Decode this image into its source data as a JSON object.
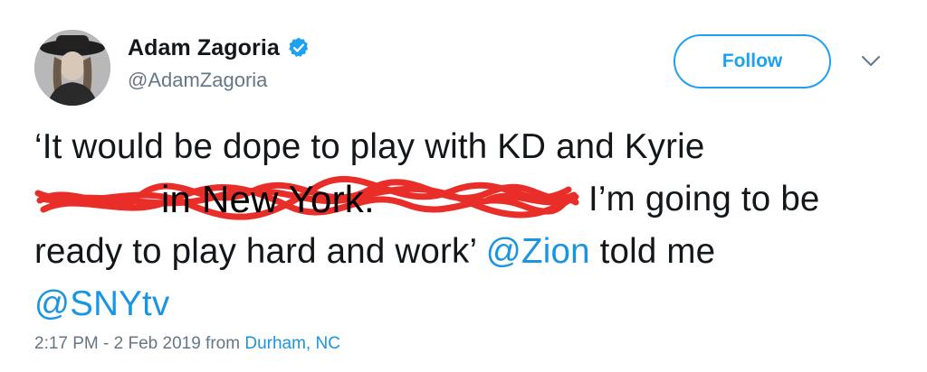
{
  "user": {
    "display_name": "Adam Zagoria",
    "handle": "@AdamZagoria",
    "verified_icon": "verified-badge-icon",
    "avatar": "profile-photo"
  },
  "actions": {
    "follow_label": "Follow",
    "more_icon": "chevron-down-icon"
  },
  "tweet": {
    "line1": "‘It would be dope to play with KD and Kyrie",
    "overlay_text": "in New York.",
    "line2_rest": "I’m going to be",
    "line3_text": "ready to play hard and work’ ",
    "mention1": "@Zion",
    "line3_tail": " told me",
    "mention2": "@SNYtv"
  },
  "meta": {
    "timestamp": "2:17 PM - 2 Feb 2019",
    "from": " from ",
    "location": "Durham, NC"
  },
  "colors": {
    "accent": "#1da1f2",
    "link": "#1b95e0",
    "muted": "#657786",
    "scribble": "#e8231e"
  }
}
